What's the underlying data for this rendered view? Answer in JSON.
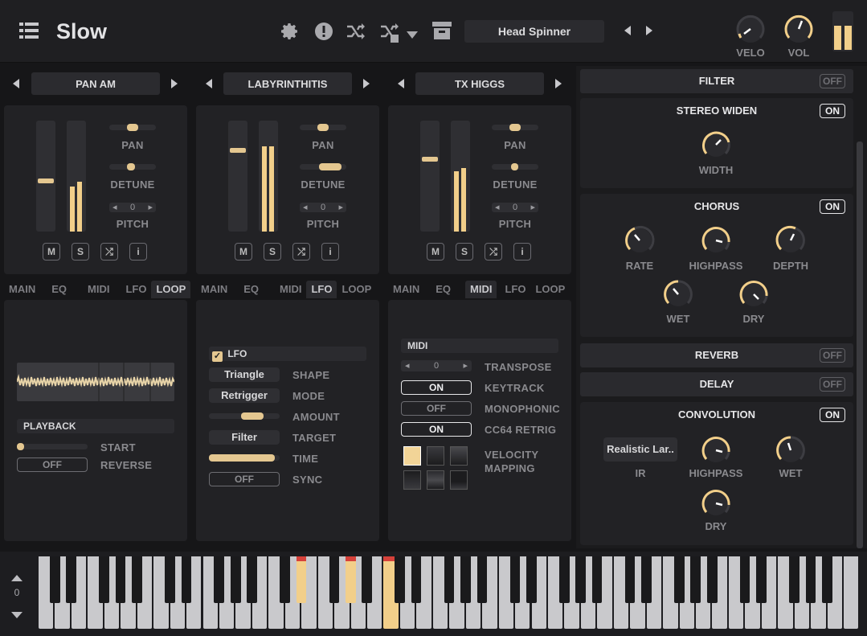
{
  "header": {
    "app_title": "Slow",
    "preset_name": "Head Spinner",
    "velo_label": "VELO",
    "vol_label": "VOL",
    "icons": [
      "menu-icon",
      "gear-icon",
      "alert-icon",
      "random-icon",
      "random-fx-icon",
      "chevron-down-icon",
      "archive-icon",
      "chevron-left-icon",
      "chevron-right-icon",
      "pause-icon"
    ]
  },
  "layers": [
    {
      "name": "PAN AM",
      "pan_label": "PAN",
      "detune_label": "DETUNE",
      "pitch_label": "PITCH",
      "pitch_value": "0",
      "buttons": [
        "M",
        "S"
      ],
      "tabs": [
        "MAIN",
        "EQ",
        "MIDI",
        "LFO",
        "LOOP"
      ],
      "active_tab": "LOOP",
      "loop": {
        "playback_label": "PLAYBACK",
        "start_label": "START",
        "reverse_label": "REVERSE",
        "reverse_value": "OFF"
      }
    },
    {
      "name": "LABYRINTHITIS",
      "pan_label": "PAN",
      "detune_label": "DETUNE",
      "pitch_label": "PITCH",
      "pitch_value": "0",
      "buttons": [
        "M",
        "S"
      ],
      "tabs": [
        "MAIN",
        "EQ",
        "MIDI",
        "LFO",
        "LOOP"
      ],
      "active_tab": "LFO",
      "lfo": {
        "enable_label": "LFO",
        "shape_value": "Triangle",
        "shape_label": "SHAPE",
        "mode_value": "Retrigger",
        "mode_label": "MODE",
        "amount_label": "AMOUNT",
        "target_value": "Filter",
        "target_label": "TARGET",
        "time_label": "TIME",
        "sync_value": "OFF",
        "sync_label": "SYNC"
      }
    },
    {
      "name": "TX HIGGS",
      "pan_label": "PAN",
      "detune_label": "DETUNE",
      "pitch_label": "PITCH",
      "pitch_value": "0",
      "buttons": [
        "M",
        "S"
      ],
      "tabs": [
        "MAIN",
        "EQ",
        "MIDI",
        "LFO",
        "LOOP"
      ],
      "active_tab": "MIDI",
      "midi": {
        "section_label": "MIDI",
        "transpose_value": "0",
        "transpose_label": "TRANSPOSE",
        "keytrack_value": "ON",
        "keytrack_label": "KEYTRACK",
        "mono_value": "OFF",
        "mono_label": "MONOPHONIC",
        "retrig_value": "ON",
        "retrig_label": "CC64 RETRIG",
        "velocity_label_1": "VELOCITY",
        "velocity_label_2": "MAPPING"
      }
    }
  ],
  "effects": {
    "filter": {
      "title": "FILTER",
      "state": "OFF"
    },
    "stereo": {
      "title": "STEREO WIDEN",
      "state": "ON",
      "width_label": "WIDTH"
    },
    "chorus": {
      "title": "CHORUS",
      "state": "ON",
      "rate_label": "RATE",
      "highpass_label": "HIGHPASS",
      "depth_label": "DEPTH",
      "wet_label": "WET",
      "dry_label": "DRY"
    },
    "reverb": {
      "title": "REVERB",
      "state": "OFF"
    },
    "delay": {
      "title": "DELAY",
      "state": "OFF"
    },
    "convolution": {
      "title": "CONVOLUTION",
      "state": "ON",
      "ir_value": "Realistic Lar..",
      "ir_label": "IR",
      "highpass_label": "HIGHPASS",
      "wet_label": "WET",
      "dry_label": "DRY"
    }
  },
  "keyboard": {
    "octave_value": "0"
  },
  "colors": {
    "accent": "#f2cf8a",
    "background": "#161618",
    "panel": "#222225",
    "key_marker": "#d6413a"
  }
}
